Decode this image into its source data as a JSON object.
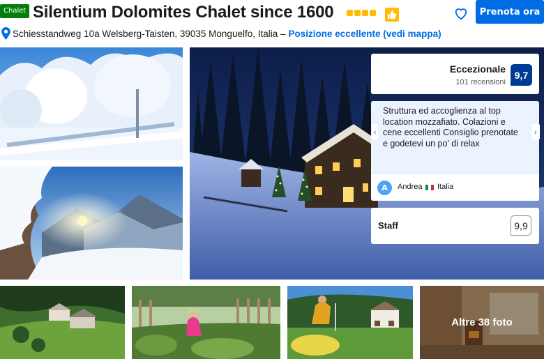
{
  "header": {
    "property_type": "Chalet",
    "title": "Silentium Dolomites Chalet since 1600",
    "stars": 4,
    "book_button": "Prenota ora",
    "address": "Schiesstandweg 10a Welsberg-Taisten, 39035 Monguelfo, Italia –",
    "location_link": "Posizione eccellente (vedi mappa)"
  },
  "colors": {
    "brand_blue": "#006ce4",
    "score_blue": "#003b95",
    "type_badge_green": "#008009",
    "star_yellow": "#febb02",
    "review_bg": "#ebf3ff"
  },
  "icons": [
    "pin-icon",
    "thumbs-up-icon",
    "heart-icon",
    "chevron-left-icon",
    "chevron-right-icon"
  ],
  "rating": {
    "word": "Eccezionale",
    "count": "101 recensioni",
    "score": "9,7"
  },
  "review": {
    "text": "Struttura ed accoglienza al top location mozzafiato. Colazioni e cene eccellenti Consiglio prenotate e godetevi un po' di relax",
    "avatar_letter": "A",
    "author": "Andrea",
    "country": "Italia"
  },
  "staff": {
    "label": "Staff",
    "score": "9,9"
  },
  "gallery": {
    "more_photos": "Altre 38 foto"
  }
}
